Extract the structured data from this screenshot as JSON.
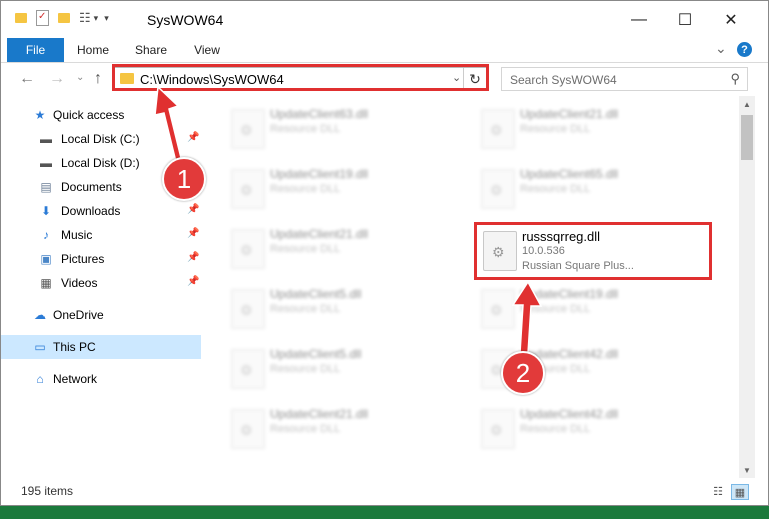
{
  "window": {
    "title": "SysWOW64",
    "minimize_icon": "—",
    "maximize_icon": "☐",
    "close_icon": "✕"
  },
  "ribbon": {
    "tabs": [
      {
        "label": "File"
      },
      {
        "label": "Home"
      },
      {
        "label": "Share"
      },
      {
        "label": "View"
      }
    ],
    "expand_icon": "⌄",
    "help_icon": "?"
  },
  "navigation": {
    "back_icon": "←",
    "forward_icon": "→",
    "recent_icon": "⌄",
    "up_icon": "↑",
    "address": "C:\\Windows\\SysWOW64",
    "refresh_icon": "↻",
    "search_placeholder": "Search SysWOW64",
    "search_icon": "⚲"
  },
  "sidebar": {
    "items": [
      {
        "label": "Quick access",
        "icon": "★"
      },
      {
        "label": "Local Disk (C:)",
        "icon": "▬"
      },
      {
        "label": "Local Disk (D:)",
        "icon": "▬"
      },
      {
        "label": "Documents",
        "icon": "▤"
      },
      {
        "label": "Downloads",
        "icon": "⬇"
      },
      {
        "label": "Music",
        "icon": "♪"
      },
      {
        "label": "Pictures",
        "icon": "▣"
      },
      {
        "label": "Videos",
        "icon": "▦"
      },
      {
        "label": "OneDrive",
        "icon": "☁"
      },
      {
        "label": "This PC",
        "icon": "▭"
      },
      {
        "label": "Network",
        "icon": "⌂"
      }
    ],
    "pin_icon": "📌"
  },
  "files": {
    "left_column": [
      {
        "name": "UpdateClient63.dll",
        "type": "Resource DLL"
      },
      {
        "name": "UpdateClient19.dll",
        "type": "Resource DLL"
      },
      {
        "name": "UpdateClient21.dll",
        "type": "Resource DLL"
      },
      {
        "name": "UpdateClient5.dll",
        "type": "Resource DLL"
      },
      {
        "name": "UpdateClient5.dll",
        "type": "Resource DLL"
      },
      {
        "name": "UpdateClient21.dll",
        "type": "Resource DLL"
      }
    ],
    "right_column": [
      {
        "name": "UpdateClient21.dll",
        "type": "Resource DLL"
      },
      {
        "name": "UpdateClient65.dll",
        "type": "Resource DLL"
      },
      {
        "name": "russsqrreg.dll",
        "version": "10.0.536",
        "description": "Russian Square Plus..."
      },
      {
        "name": "UpdateClient19.dll",
        "type": "Resource DLL"
      },
      {
        "name": "UpdateClient42.dll",
        "type": "Resource DLL"
      },
      {
        "name": "UpdateClient42.dll",
        "type": "Resource DLL"
      }
    ]
  },
  "annotations": {
    "step1": "1",
    "step2": "2",
    "color": "#e03030"
  },
  "status": {
    "item_count": "195 items",
    "details_view_icon": "☷",
    "large_icons_view_icon": "▦"
  },
  "scrollbar": {
    "up_icon": "▲",
    "down_icon": "▼"
  }
}
